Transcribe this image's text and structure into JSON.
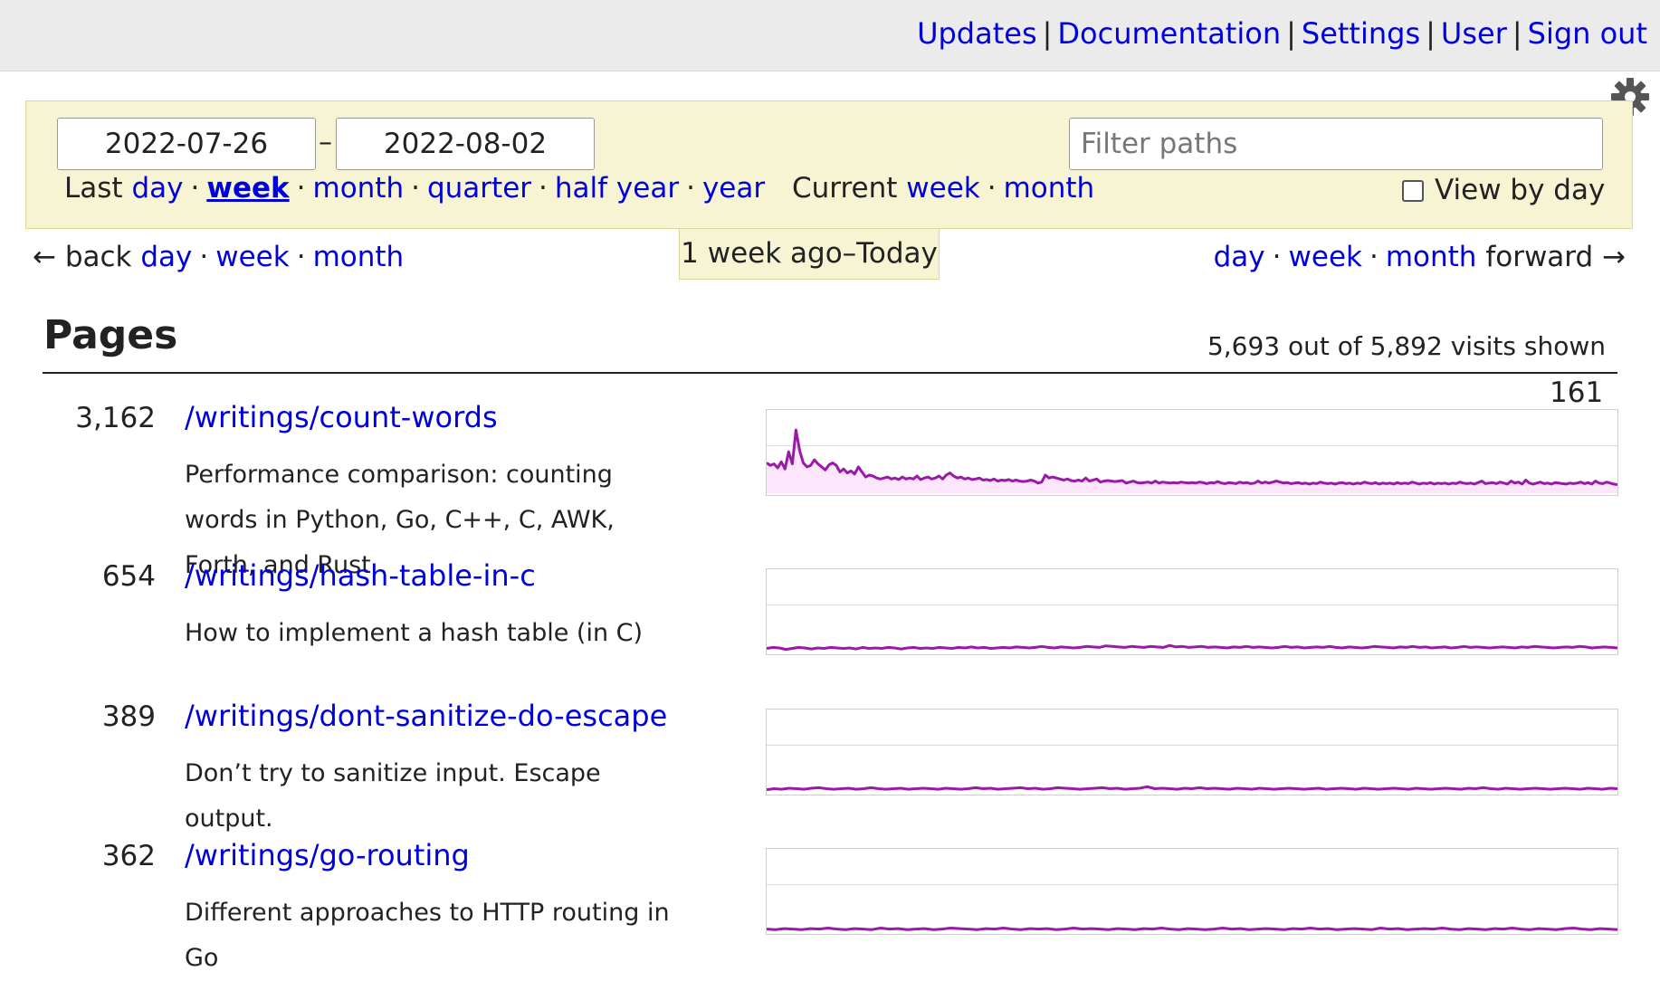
{
  "nav": {
    "items": [
      "Updates",
      "Documentation",
      "Settings",
      "User",
      "Sign out"
    ]
  },
  "filters": {
    "start_date": "2022-07-26",
    "end_date": "2022-08-02",
    "filter_placeholder": "Filter paths",
    "last_label": "Last",
    "last_options": [
      "day",
      "week",
      "month",
      "quarter",
      "half year",
      "year"
    ],
    "active_option": "week",
    "current_label": "Current",
    "current_options": [
      "week",
      "month"
    ],
    "view_by_day_label": "View by day",
    "view_by_day_checked": false
  },
  "navigation": {
    "back_label": "← back",
    "back_links": [
      "day",
      "week",
      "month"
    ],
    "range_label": "1 week ago–Today",
    "forward_links": [
      "day",
      "week",
      "month"
    ],
    "forward_label": "forward →"
  },
  "pages_section": {
    "heading": "Pages",
    "visits_summary": "5,693 out of 5,892 visits shown",
    "chart_max_label": "161",
    "rows": [
      {
        "count": "3,162",
        "path": "/writings/count-words",
        "title": "Performance comparison: counting words in Python, Go, C++, C, AWK, Forth, and Rust"
      },
      {
        "count": "654",
        "path": "/writings/hash-table-in-c",
        "title": "How to implement a hash table (in C)"
      },
      {
        "count": "389",
        "path": "/writings/dont-sanitize-do-escape",
        "title": "Don’t try to sanitize input. Escape output."
      },
      {
        "count": "362",
        "path": "/writings/go-routing",
        "title": "Different approaches to HTTP routing in Go"
      }
    ]
  },
  "colors": {
    "link": "#0000dd",
    "filter_bg": "#f6f4d2",
    "sparkline": "#9a1aa8",
    "sparkline_fill": "#fbe6fb"
  },
  "chart_data": [
    {
      "type": "area",
      "title": "/writings/count-words",
      "ylim": [
        0,
        161
      ],
      "values": [
        60,
        55,
        58,
        50,
        62,
        48,
        82,
        58,
        125,
        84,
        60,
        52,
        55,
        66,
        58,
        52,
        46,
        56,
        60,
        55,
        42,
        48,
        40,
        44,
        38,
        52,
        42,
        32,
        36,
        34,
        30,
        28,
        30,
        32,
        28,
        30,
        27,
        32,
        28,
        30,
        28,
        34,
        27,
        30,
        32,
        28,
        30,
        34,
        28,
        36,
        40,
        34,
        30,
        32,
        28,
        30,
        27,
        28,
        30,
        26,
        27,
        25,
        28,
        24,
        26,
        25,
        27,
        24,
        26,
        24,
        23,
        24,
        26,
        24,
        20,
        22,
        36,
        30,
        32,
        30,
        28,
        26,
        28,
        25,
        24,
        26,
        24,
        30,
        24,
        26,
        28,
        22,
        24,
        25,
        24,
        23,
        24,
        25,
        20,
        22,
        24,
        21,
        20,
        21,
        22,
        20,
        24,
        20,
        22,
        21,
        20,
        21,
        20,
        22,
        21,
        20,
        21,
        20,
        22,
        21,
        19,
        21,
        20,
        23,
        20,
        19,
        21,
        20,
        19,
        22,
        20,
        21,
        19,
        20,
        24,
        20,
        22,
        20,
        22,
        24,
        22,
        20,
        21,
        19,
        20,
        21,
        19,
        20,
        18,
        20,
        19,
        22,
        20,
        19,
        20,
        18,
        20,
        21,
        19,
        20,
        18,
        20,
        19,
        22,
        20,
        19,
        21,
        18,
        20,
        19,
        20,
        18,
        21,
        19,
        20,
        19,
        22,
        20,
        18,
        20,
        19,
        21,
        18,
        20,
        19,
        20,
        18,
        20,
        19,
        22,
        20,
        19,
        20,
        18,
        21,
        24,
        19,
        20,
        21,
        19,
        22,
        20,
        18,
        24,
        20,
        22,
        18,
        26,
        20,
        18,
        20,
        22,
        19,
        20,
        18,
        21,
        20,
        19,
        18,
        20,
        19,
        20,
        22,
        19,
        21,
        18,
        24,
        20,
        19,
        22,
        20,
        18,
        17
      ]
    },
    {
      "type": "line",
      "title": "/writings/hash-table-in-c",
      "ylim": [
        0,
        161
      ],
      "values": [
        8,
        10,
        9,
        6,
        8,
        10,
        9,
        7,
        9,
        8,
        10,
        9,
        8,
        9,
        7,
        10,
        8,
        9,
        8,
        10,
        9,
        7,
        9,
        10,
        8,
        9,
        8,
        10,
        9,
        8,
        10,
        9,
        11,
        9,
        10,
        8,
        9,
        10,
        9,
        11,
        10,
        9,
        10,
        12,
        10,
        9,
        11,
        10,
        9,
        10,
        12,
        11,
        10,
        13,
        12,
        11,
        10,
        12,
        11,
        10,
        12,
        11,
        10,
        14,
        11,
        12,
        10,
        11,
        12,
        10,
        11,
        10,
        9,
        11,
        10,
        12,
        10,
        11,
        10,
        9,
        10,
        12,
        10,
        11,
        9,
        10,
        11,
        10,
        12,
        10,
        9,
        11,
        10,
        9,
        10,
        12,
        11,
        10,
        9,
        11,
        10,
        12,
        10,
        11,
        9,
        10,
        11,
        9,
        10,
        12,
        10,
        11,
        10,
        9,
        10,
        11,
        10,
        9,
        11,
        10,
        12,
        11,
        10,
        9,
        10,
        11,
        10,
        12,
        11,
        9,
        10,
        11,
        10,
        9
      ]
    },
    {
      "type": "line",
      "title": "/writings/dont-sanitize-do-escape",
      "ylim": [
        0,
        161
      ],
      "values": [
        6,
        8,
        7,
        9,
        8,
        7,
        9,
        10,
        8,
        7,
        8,
        9,
        7,
        8,
        10,
        8,
        7,
        8,
        9,
        7,
        8,
        9,
        8,
        7,
        9,
        8,
        7,
        8,
        10,
        8,
        9,
        7,
        8,
        9,
        10,
        8,
        9,
        7,
        8,
        10,
        9,
        8,
        7,
        8,
        9,
        10,
        8,
        9,
        7,
        8,
        9,
        12,
        8,
        9,
        8,
        7,
        9,
        8,
        10,
        8,
        9,
        8,
        7,
        9,
        8,
        7,
        9,
        8,
        7,
        8,
        9,
        8,
        7,
        8,
        9,
        7,
        8,
        9,
        8,
        7,
        9,
        8,
        7,
        8,
        9,
        8,
        7,
        9,
        8,
        7,
        8,
        9,
        8,
        7,
        9,
        8,
        10,
        8,
        7,
        9,
        8,
        7,
        8,
        9,
        8,
        7,
        8,
        9,
        8,
        7,
        9,
        8,
        7,
        9,
        8
      ]
    },
    {
      "type": "line",
      "title": "/writings/go-routing",
      "ylim": [
        0,
        161
      ],
      "values": [
        6,
        5,
        7,
        6,
        5,
        7,
        6,
        8,
        6,
        5,
        7,
        6,
        5,
        8,
        6,
        7,
        5,
        6,
        7,
        5,
        6,
        8,
        7,
        6,
        5,
        7,
        6,
        8,
        6,
        5,
        7,
        6,
        7,
        5,
        6,
        8,
        6,
        7,
        6,
        5,
        7,
        6,
        5,
        7,
        6,
        8,
        6,
        5,
        7,
        6,
        5,
        6,
        8,
        6,
        7,
        5,
        6,
        7,
        6,
        5,
        7,
        6,
        8,
        6,
        7,
        5,
        6,
        7,
        6,
        5,
        8,
        6,
        7,
        5,
        6,
        7,
        6,
        8,
        6,
        5,
        7,
        6,
        5,
        7,
        6,
        8,
        6,
        5,
        7,
        6,
        5,
        7,
        8,
        6,
        5,
        7,
        6,
        5
      ]
    }
  ]
}
